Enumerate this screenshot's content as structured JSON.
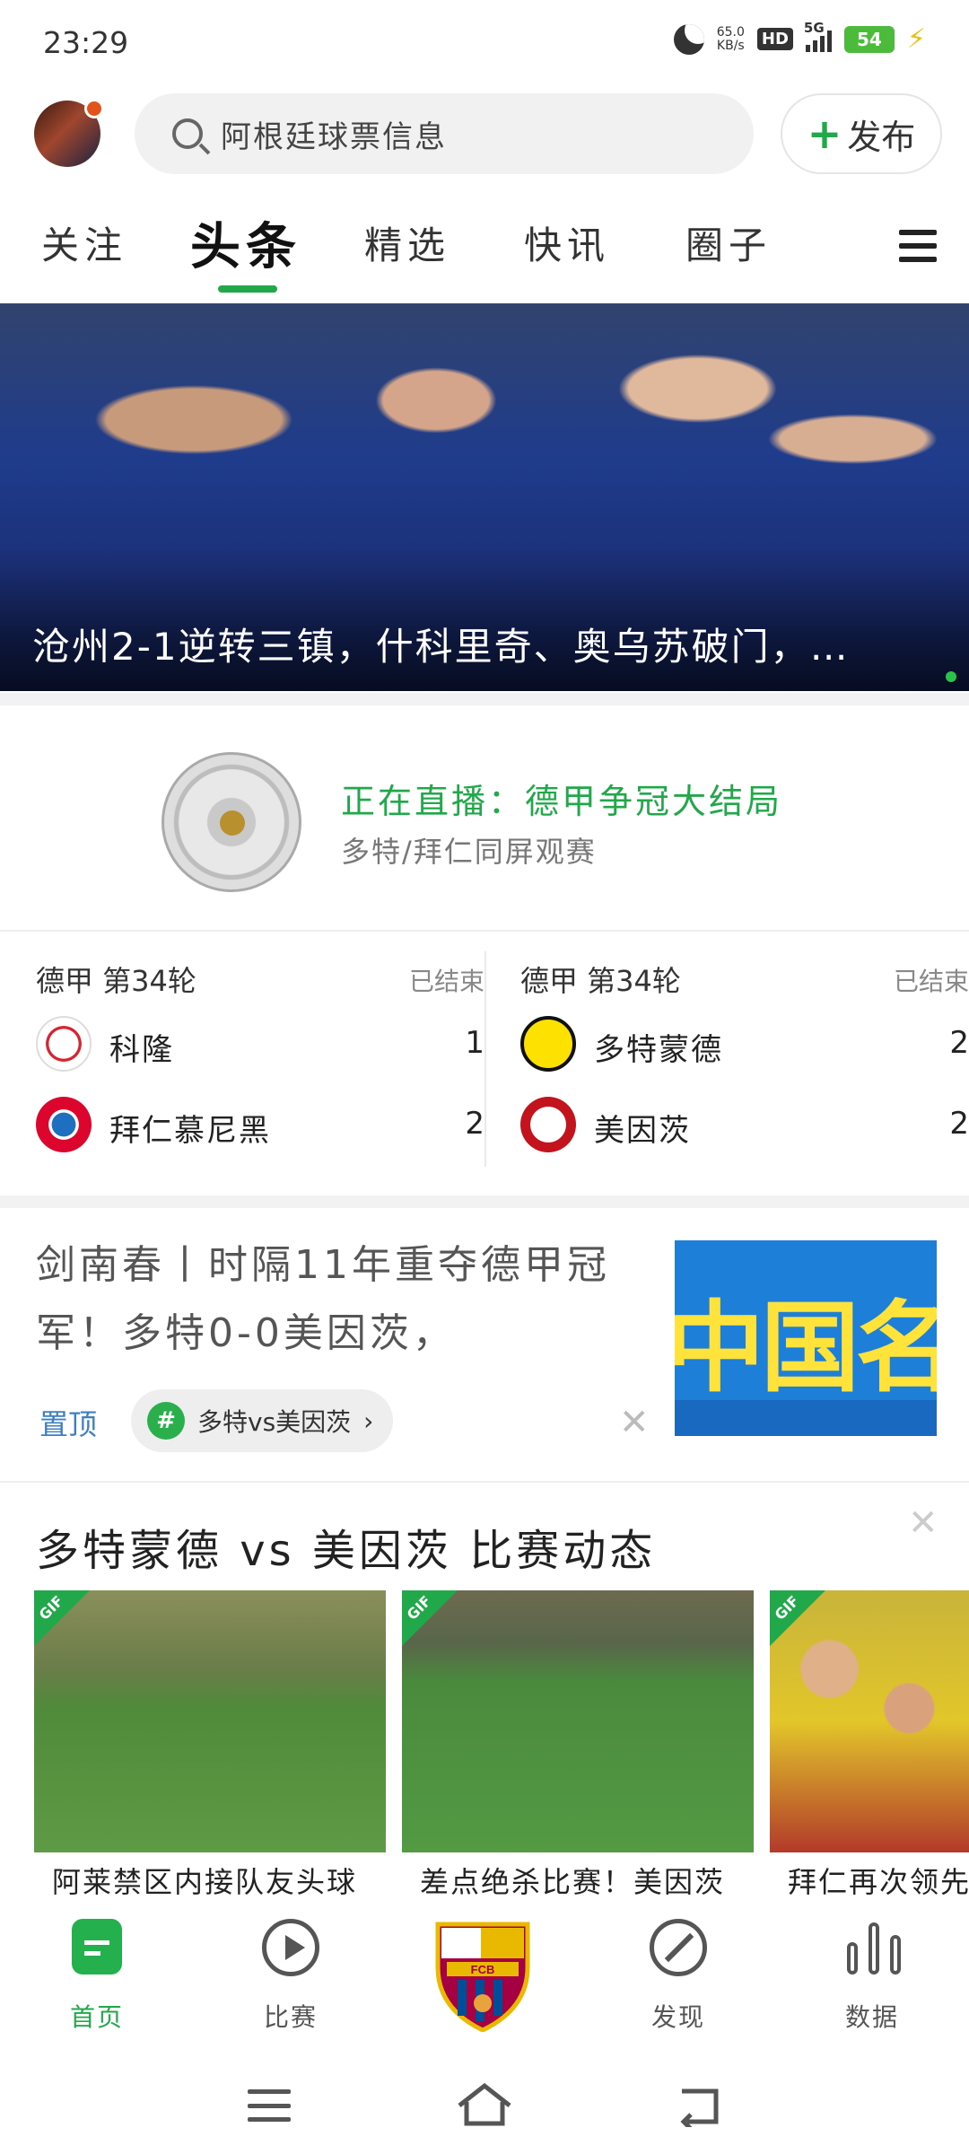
{
  "status_bar": {
    "time": "23:29",
    "speed_value": "65.0",
    "speed_unit": "KB/s",
    "hd": "HD",
    "network": "5G",
    "battery": "54"
  },
  "header": {
    "search_placeholder": "阿根廷球票信息",
    "post_label": "发布"
  },
  "tabs": [
    {
      "label": "关注"
    },
    {
      "label": "头条"
    },
    {
      "label": "精选"
    },
    {
      "label": "快讯"
    },
    {
      "label": "圈子"
    }
  ],
  "hero": {
    "title": "沧州2-1逆转三镇，什科里奇、奥乌苏破门，…"
  },
  "live": {
    "title": "正在直播：德甲争冠大结局",
    "subtitle": "多特/拜仁同屏观赛"
  },
  "matches": [
    {
      "league": "德甲 第34轮",
      "status": "已结束",
      "teams": [
        {
          "name": "科隆",
          "score": "1"
        },
        {
          "name": "拜仁慕尼黑",
          "score": "2"
        }
      ]
    },
    {
      "league": "德甲 第34轮",
      "status": "已结束",
      "teams": [
        {
          "name": "多特蒙德",
          "score": "2"
        },
        {
          "name": "美因茨",
          "score": "2"
        }
      ]
    }
  ],
  "article": {
    "title": "剑南春丨时隔11年重夺德甲冠军！多特0-0美因茨，",
    "pin_label": "置顶",
    "tag": "多特vs美因茨",
    "thumb_text": "中国名"
  },
  "feed": {
    "title": "多特蒙德 vs 美因茨 比赛动态",
    "gif_label": "GIF",
    "items": [
      {
        "caption": "阿莱禁区内接队友头球"
      },
      {
        "caption": "差点绝杀比赛！美因茨"
      },
      {
        "caption": "拜仁再次领先"
      }
    ]
  },
  "bottom_nav": [
    {
      "label": "首页"
    },
    {
      "label": "比赛"
    },
    {
      "label": "发现"
    },
    {
      "label": "数据"
    }
  ],
  "club_logo_text": "FCB",
  "colors": {
    "accent": "#21a84a",
    "pin": "#3d7fc1"
  }
}
